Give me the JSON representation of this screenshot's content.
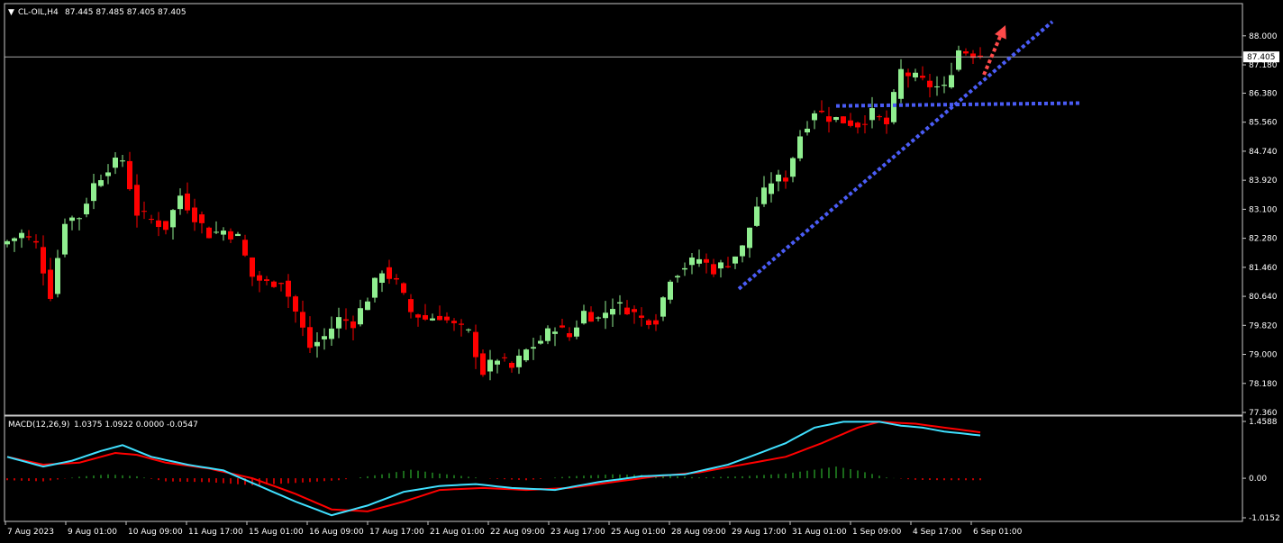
{
  "main_header": {
    "arrow": "▼",
    "symbol": "CL-OIL,H4",
    "ohlc": "87.445 87.485 87.405 87.405"
  },
  "macd_header": {
    "label": "MACD(12,26,9)",
    "values": "1.0375 1.0922 0.0000 -0.0547"
  },
  "colors": {
    "background": "#000000",
    "bull": "#90ee90",
    "bear": "#ff0000",
    "grid": "#ffffff",
    "trendline": "#4a5cf5",
    "arrow": "#ff4a4a",
    "macd_line": "#40e0ff",
    "signal_line": "#ff0000",
    "hist_pos": "#228b22",
    "hist_neg": "#ff0000"
  },
  "chart_data": [
    {
      "type": "candlestick",
      "title": "CL-OIL,H4",
      "ylim": [
        77.36,
        88.3
      ],
      "price_ticks": [
        "88.000",
        "87.180",
        "86.380",
        "85.560",
        "84.740",
        "83.920",
        "83.100",
        "82.280",
        "81.460",
        "80.640",
        "79.820",
        "79.000",
        "78.180",
        "77.360"
      ],
      "current_price": "87.405",
      "x_labels": [
        "7 Aug 2023",
        "9 Aug 01:00",
        "10 Aug 09:00",
        "11 Aug 17:00",
        "15 Aug 01:00",
        "16 Aug 09:00",
        "17 Aug 17:00",
        "21 Aug 01:00",
        "22 Aug 09:00",
        "23 Aug 17:00",
        "25 Aug 01:00",
        "28 Aug 09:00",
        "29 Aug 17:00",
        "31 Aug 01:00",
        "1 Sep 09:00",
        "4 Sep 17:00",
        "6 Sep 01:00"
      ],
      "anchors": [
        [
          0,
          82.2
        ],
        [
          2,
          82.4
        ],
        [
          4,
          82.1
        ],
        [
          6,
          80.7
        ],
        [
          8,
          82.8
        ],
        [
          10,
          82.9
        ],
        [
          12,
          83.8
        ],
        [
          14,
          84.3
        ],
        [
          16,
          84.5
        ],
        [
          18,
          83.0
        ],
        [
          20,
          82.8
        ],
        [
          22,
          82.6
        ],
        [
          24,
          83.5
        ],
        [
          26,
          82.9
        ],
        [
          28,
          82.4
        ],
        [
          30,
          82.5
        ],
        [
          32,
          82.3
        ],
        [
          34,
          81.2
        ],
        [
          36,
          81.0
        ],
        [
          38,
          81.1
        ],
        [
          40,
          80.2
        ],
        [
          42,
          79.2
        ],
        [
          44,
          79.5
        ],
        [
          46,
          80.0
        ],
        [
          48,
          79.9
        ],
        [
          50,
          80.6
        ],
        [
          52,
          81.4
        ],
        [
          54,
          81.0
        ],
        [
          56,
          80.2
        ],
        [
          58,
          80.0
        ],
        [
          60,
          80.1
        ],
        [
          62,
          79.8
        ],
        [
          64,
          79.6
        ],
        [
          66,
          78.5
        ],
        [
          68,
          78.9
        ],
        [
          70,
          78.6
        ],
        [
          72,
          79.1
        ],
        [
          74,
          79.4
        ],
        [
          76,
          79.8
        ],
        [
          78,
          79.5
        ],
        [
          80,
          80.2
        ],
        [
          82,
          80.0
        ],
        [
          84,
          80.4
        ],
        [
          86,
          80.3
        ],
        [
          88,
          80.0
        ],
        [
          90,
          80.0
        ],
        [
          92,
          81.2
        ],
        [
          94,
          81.5
        ],
        [
          96,
          81.7
        ],
        [
          98,
          81.4
        ],
        [
          100,
          81.6
        ],
        [
          102,
          82.0
        ],
        [
          104,
          83.2
        ],
        [
          106,
          83.9
        ],
        [
          108,
          84.0
        ],
        [
          110,
          85.2
        ],
        [
          112,
          85.9
        ],
        [
          114,
          85.7
        ],
        [
          116,
          85.6
        ],
        [
          118,
          85.5
        ],
        [
          120,
          85.8
        ],
        [
          122,
          85.5
        ],
        [
          124,
          87.0
        ],
        [
          126,
          86.8
        ],
        [
          128,
          86.6
        ],
        [
          130,
          86.5
        ],
        [
          132,
          87.6
        ],
        [
          134,
          87.5
        ],
        [
          135,
          87.405
        ]
      ],
      "trendlines": [
        {
          "name": "ascending-support",
          "from": [
            101.5,
            80.85
          ],
          "to": [
            145,
            88.4
          ]
        },
        {
          "name": "horizontal-resistance",
          "from": [
            115,
            86.02
          ],
          "to": [
            149,
            86.1
          ]
        }
      ],
      "projection_arrow": {
        "from": [
          135.5,
          86.9
        ],
        "to": [
          138.5,
          88.3
        ]
      }
    },
    {
      "type": "macd",
      "title": "MACD(12,26,9)",
      "ylim": [
        -1.0152,
        1.4588
      ],
      "ticks": [
        "1.4588",
        "0.00",
        "-1.0152"
      ],
      "macd_anchors": [
        [
          0,
          0.55
        ],
        [
          5,
          0.3
        ],
        [
          9,
          0.45
        ],
        [
          13,
          0.7
        ],
        [
          16,
          0.85
        ],
        [
          20,
          0.55
        ],
        [
          25,
          0.35
        ],
        [
          30,
          0.2
        ],
        [
          35,
          -0.2
        ],
        [
          40,
          -0.6
        ],
        [
          45,
          -0.95
        ],
        [
          50,
          -0.7
        ],
        [
          55,
          -0.35
        ],
        [
          60,
          -0.2
        ],
        [
          65,
          -0.15
        ],
        [
          70,
          -0.25
        ],
        [
          76,
          -0.3
        ],
        [
          82,
          -0.1
        ],
        [
          88,
          0.05
        ],
        [
          94,
          0.1
        ],
        [
          100,
          0.35
        ],
        [
          103,
          0.55
        ],
        [
          108,
          0.9
        ],
        [
          112,
          1.3
        ],
        [
          116,
          1.45
        ],
        [
          121,
          1.45
        ],
        [
          124,
          1.35
        ],
        [
          127,
          1.3
        ],
        [
          130,
          1.2
        ],
        [
          135,
          1.1
        ]
      ],
      "signal_anchors": [
        [
          0,
          0.55
        ],
        [
          5,
          0.35
        ],
        [
          10,
          0.4
        ],
        [
          15,
          0.65
        ],
        [
          18,
          0.6
        ],
        [
          22,
          0.4
        ],
        [
          28,
          0.25
        ],
        [
          34,
          0.0
        ],
        [
          40,
          -0.4
        ],
        [
          45,
          -0.8
        ],
        [
          50,
          -0.85
        ],
        [
          55,
          -0.6
        ],
        [
          60,
          -0.3
        ],
        [
          66,
          -0.25
        ],
        [
          72,
          -0.3
        ],
        [
          78,
          -0.25
        ],
        [
          84,
          -0.1
        ],
        [
          90,
          0.05
        ],
        [
          96,
          0.15
        ],
        [
          102,
          0.35
        ],
        [
          108,
          0.55
        ],
        [
          113,
          0.9
        ],
        [
          118,
          1.3
        ],
        [
          121,
          1.45
        ],
        [
          126,
          1.4
        ],
        [
          130,
          1.3
        ],
        [
          135,
          1.18
        ]
      ],
      "hist_anchors": [
        [
          0,
          -0.05
        ],
        [
          5,
          -0.08
        ],
        [
          10,
          0.04
        ],
        [
          14,
          0.1
        ],
        [
          18,
          0.05
        ],
        [
          22,
          -0.08
        ],
        [
          28,
          -0.1
        ],
        [
          34,
          -0.18
        ],
        [
          40,
          -0.12
        ],
        [
          46,
          -0.05
        ],
        [
          52,
          0.1
        ],
        [
          56,
          0.22
        ],
        [
          60,
          0.12
        ],
        [
          66,
          0.0
        ],
        [
          72,
          -0.05
        ],
        [
          78,
          0.05
        ],
        [
          84,
          0.1
        ],
        [
          90,
          0.08
        ],
        [
          96,
          0.02
        ],
        [
          102,
          0.05
        ],
        [
          108,
          0.12
        ],
        [
          112,
          0.22
        ],
        [
          115,
          0.3
        ],
        [
          118,
          0.2
        ],
        [
          122,
          0.02
        ],
        [
          126,
          -0.04
        ],
        [
          130,
          -0.05
        ],
        [
          135,
          -0.05
        ]
      ]
    }
  ]
}
